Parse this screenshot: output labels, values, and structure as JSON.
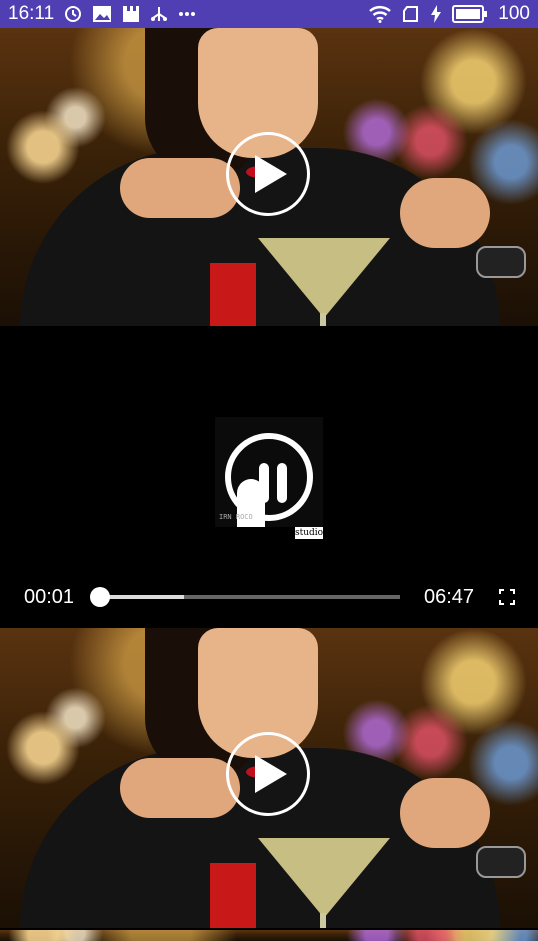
{
  "status_bar": {
    "time": "16:11",
    "battery_level": "100",
    "left_icons": [
      "alarm-icon",
      "image-icon",
      "app-icon",
      "usb-icon",
      "more-icon"
    ],
    "right_icons": [
      "wifi-icon",
      "sim-icon",
      "charging-icon",
      "battery-icon"
    ],
    "background_color": "#4f3fb3"
  },
  "video_list": {
    "items": [
      {
        "thumbnail": "woman-with-martini",
        "control": "play-icon"
      },
      {
        "thumbnail": "woman-with-martini",
        "control": "play-icon"
      }
    ]
  },
  "player": {
    "logo_text": "studio",
    "logo_side_text": "IRN ROCO",
    "current_time": "00:01",
    "total_time": "06:47",
    "playback_progress": 0.0,
    "buffered_progress": 0.28,
    "fullscreen_icon": "fullscreen-icon"
  }
}
